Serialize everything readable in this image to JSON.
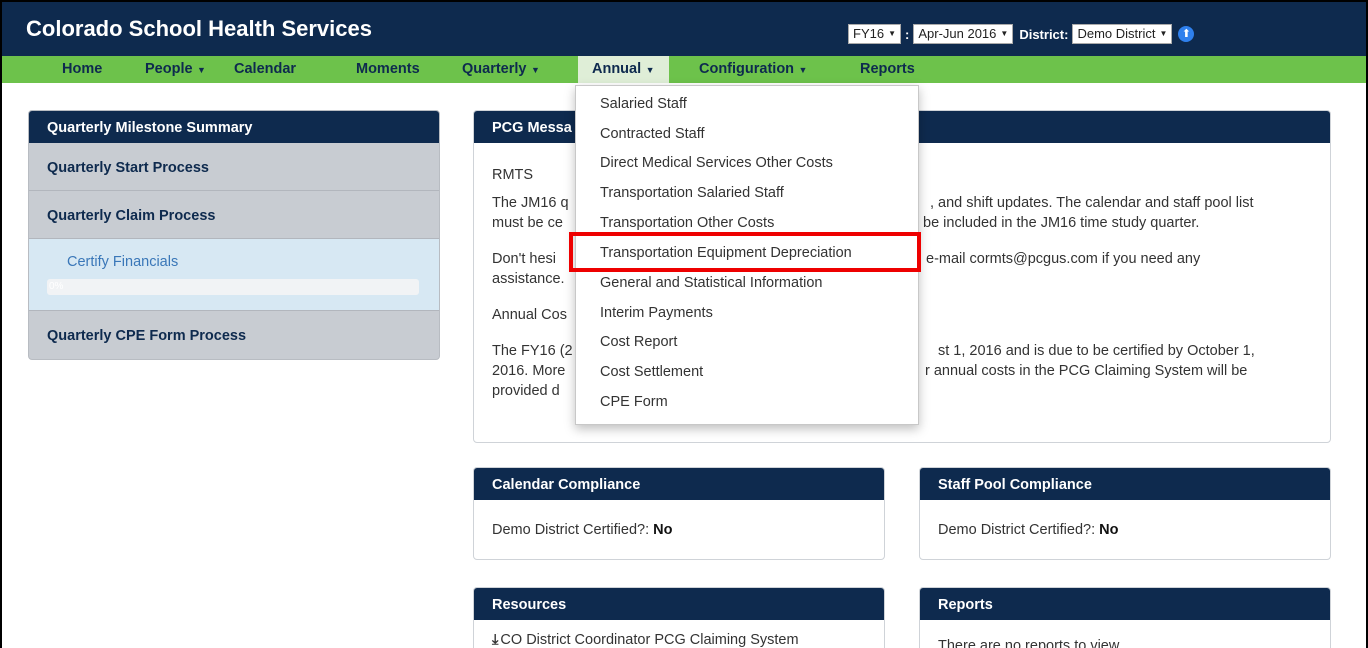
{
  "app": {
    "title": "Colorado School Health Services"
  },
  "selectors": {
    "fiscal_year": "FY16",
    "quarter": "Apr-Jun 2016",
    "district_label": "District:",
    "district": "Demo District"
  },
  "nav": {
    "home": "Home",
    "people": "People",
    "calendar": "Calendar",
    "moments": "Moments",
    "quarterly": "Quarterly",
    "annual": "Annual",
    "configuration": "Configuration",
    "reports": "Reports"
  },
  "annual_menu": [
    "Salaried Staff",
    "Contracted Staff",
    "Direct Medical Services Other Costs",
    "Transportation Salaried Staff",
    "Transportation Other Costs",
    "Transportation Equipment Depreciation",
    "General and Statistical Information",
    "Interim Payments",
    "Cost Report",
    "Cost Settlement",
    "CPE Form"
  ],
  "milestones": {
    "title": "Quarterly Milestone Summary",
    "start": "Quarterly Start Process",
    "claim": "Quarterly Claim Process",
    "certify_link": "Certify Financials",
    "progress_text": "0%",
    "cpe": "Quarterly CPE Form Process"
  },
  "messages": {
    "title": "PCG Messa",
    "rmts": "RMTS",
    "p1_left1": "The JM16 q",
    "p1_right1": ", and shift updates. The calendar and staff pool list",
    "p1_left2": "must be ce",
    "p1_right2": "be included in the JM16 time study quarter.",
    "p2_left1": "Don't hesi",
    "p2_right1": "e-mail cormts@pcgus.com if you need any",
    "p2_left2": "assistance.",
    "annual_left": "Annual Cos",
    "p3_left1": "The FY16 (2",
    "p3_right1": "st 1, 2016 and is due to be certified by October 1,",
    "p3_left2": "2016. More",
    "p3_right2": "r annual costs in the PCG Claiming System will be",
    "p3_left3": "provided d"
  },
  "calendar_compliance": {
    "title": "Calendar Compliance",
    "label": "Demo District Certified?:",
    "value": "No"
  },
  "staff_pool_compliance": {
    "title": "Staff Pool Compliance",
    "label": "Demo District Certified?:",
    "value": "No"
  },
  "resources": {
    "title": "Resources",
    "item": "CO District Coordinator PCG Claiming System"
  },
  "reports_panel": {
    "title": "Reports",
    "empty": "There are no reports to view."
  }
}
